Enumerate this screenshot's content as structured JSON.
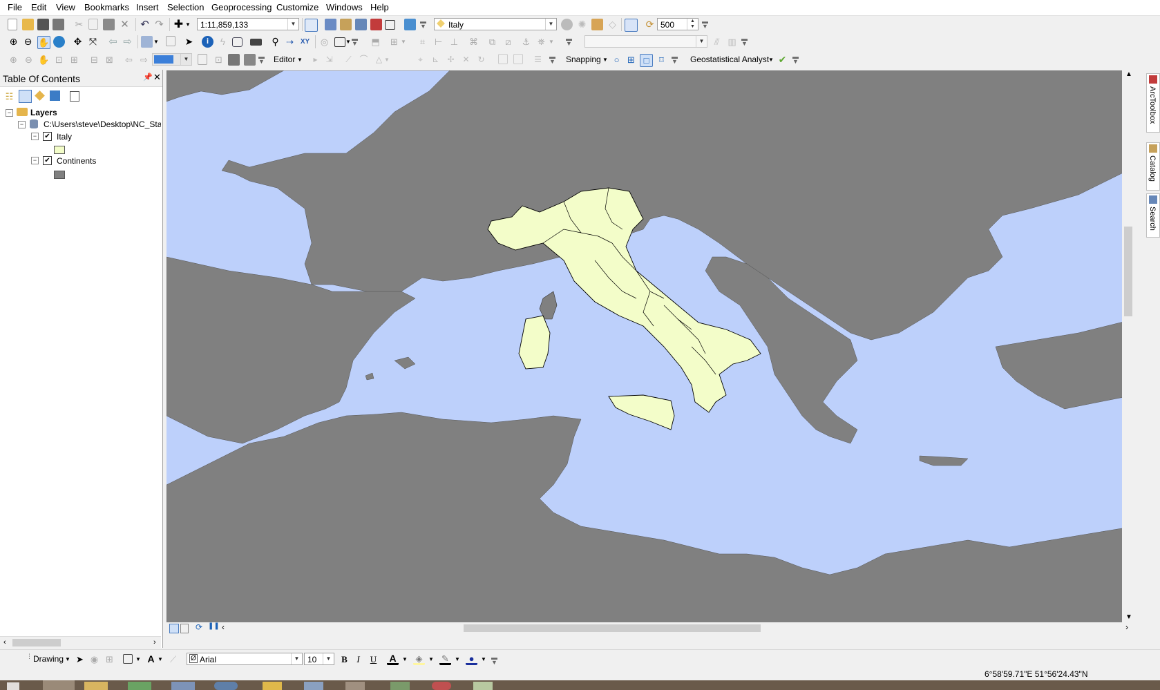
{
  "menu": [
    "File",
    "Edit",
    "View",
    "Bookmarks",
    "Insert",
    "Selection",
    "Geoprocessing",
    "Customize",
    "Windows",
    "Help"
  ],
  "standard_toolbar": {
    "scale": "1:11,859,133",
    "layer": "Italy",
    "resolution": "500"
  },
  "editor_toolbar": {
    "editor_label": "Editor",
    "snapping_label": "Snapping",
    "geo_label": "Geostatistical Analyst"
  },
  "toc": {
    "title": "Table Of Contents",
    "root": "Layers",
    "datasource": "C:\\Users\\steve\\Desktop\\NC_Stat",
    "layers": [
      {
        "name": "Italy",
        "checked": true,
        "swatch": "#f3fdc9"
      },
      {
        "name": "Continents",
        "checked": true,
        "swatch": "#808080"
      }
    ]
  },
  "map": {
    "sea_color": "#bdd0fb",
    "land_color": "#808080",
    "italy_color": "#f3fdc9"
  },
  "dock_tabs": [
    "ArcToolbox",
    "Catalog",
    "Search"
  ],
  "drawing_toolbar": {
    "drawing_label": "Drawing",
    "font": "Arial",
    "size": "10"
  },
  "status": {
    "coordinates": "6°58'59.71\"E  51°56'24.43\"N"
  }
}
